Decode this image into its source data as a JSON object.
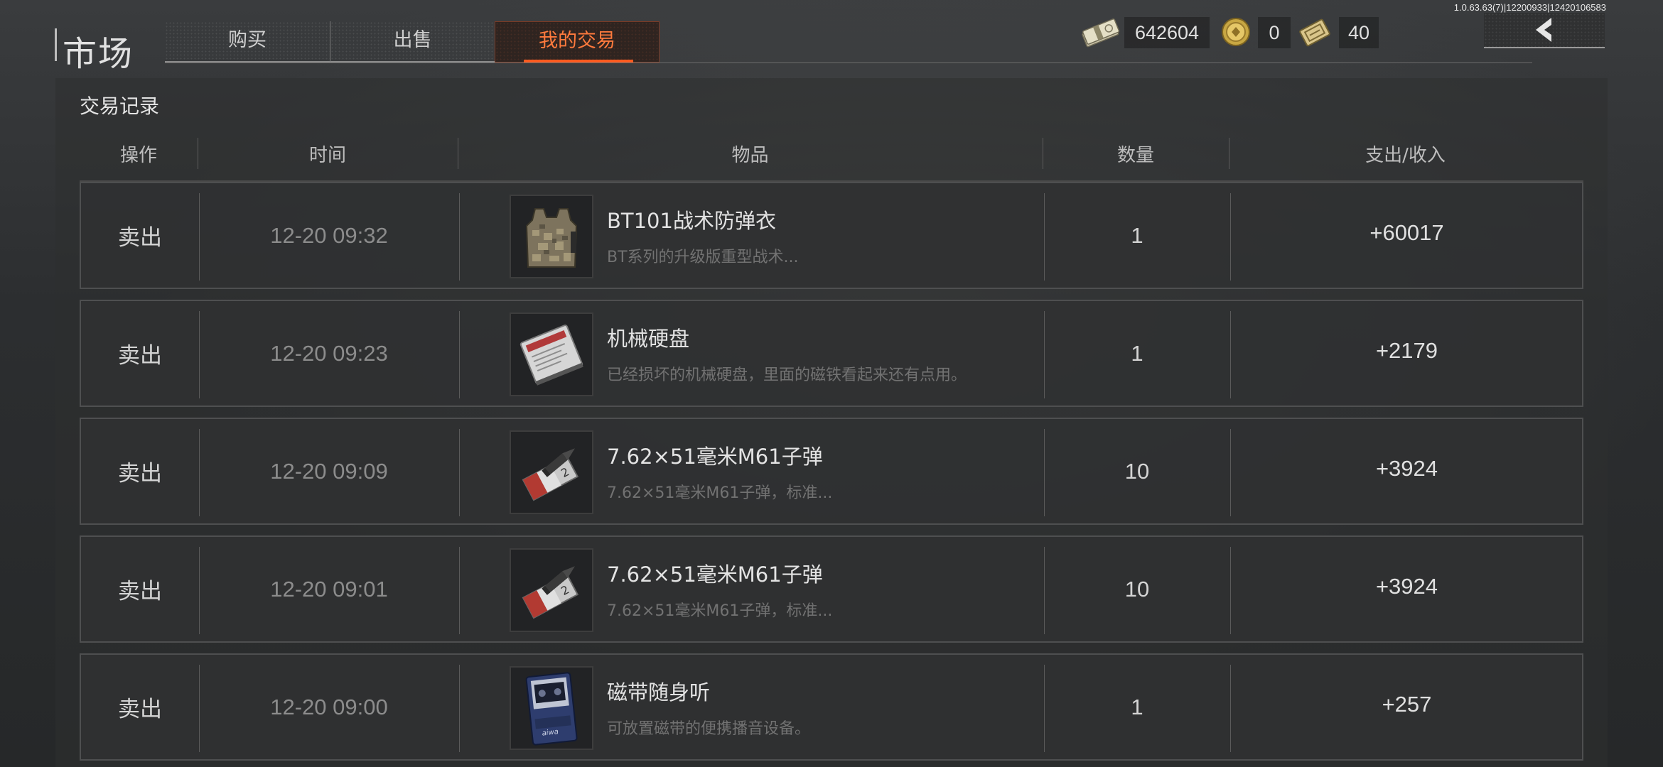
{
  "version": "1.0.63.63(7)|12200933|12420106583",
  "header": {
    "title": "市场",
    "tabs": [
      {
        "label": "购买"
      },
      {
        "label": "出售"
      },
      {
        "label": "我的交易"
      }
    ],
    "active_tab": 2
  },
  "currencies": {
    "cash": "642604",
    "coin": "0",
    "ticket": "40"
  },
  "colors": {
    "accent": "#ff5a1f",
    "accent_text": "#ff7a3d"
  },
  "panel": {
    "title": "交易记录",
    "columns": [
      "操作",
      "时间",
      "物品",
      "数量",
      "支出/收入"
    ]
  },
  "rows": [
    {
      "op": "卖出",
      "time": "12-20 09:32",
      "name": "BT101战术防弹衣",
      "desc": "BT系列的升级版重型战术...",
      "qty": "1",
      "amount": "+60017",
      "icon": "tactical-vest-icon"
    },
    {
      "op": "卖出",
      "time": "12-20 09:23",
      "name": "机械硬盘",
      "desc": "已经损坏的机械硬盘，里面的磁铁看起来还有点用。",
      "qty": "1",
      "amount": "+2179",
      "icon": "hard-drive-icon"
    },
    {
      "op": "卖出",
      "time": "12-20 09:09",
      "name": "7.62×51毫米M61子弹",
      "desc": "7.62×51毫米M61子弹，标准...",
      "qty": "10",
      "amount": "+3924",
      "icon": "ammo-box-icon"
    },
    {
      "op": "卖出",
      "time": "12-20 09:01",
      "name": "7.62×51毫米M61子弹",
      "desc": "7.62×51毫米M61子弹，标准...",
      "qty": "10",
      "amount": "+3924",
      "icon": "ammo-box-icon"
    },
    {
      "op": "卖出",
      "time": "12-20 09:00",
      "name": "磁带随身听",
      "desc": "可放置磁带的便携播音设备。",
      "qty": "1",
      "amount": "+257",
      "icon": "cassette-player-icon"
    }
  ]
}
